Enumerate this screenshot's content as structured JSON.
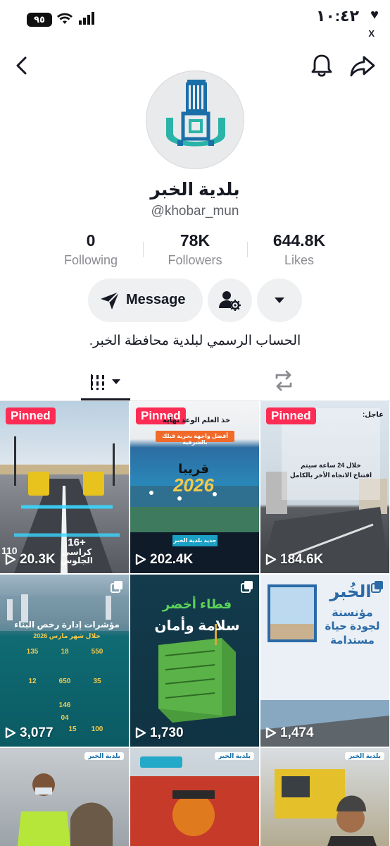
{
  "status_bar": {
    "time": "١٠:٤٢",
    "battery": "٩٥",
    "app_return": "X"
  },
  "profile": {
    "display_name": "بلدية الخبر",
    "handle": "@khobar_mun",
    "bio": "الحساب الرسمي لبلدية محافظة الخبر."
  },
  "stats": {
    "following": {
      "value": "0",
      "label": "Following"
    },
    "followers": {
      "value": "78K",
      "label": "Followers"
    },
    "likes": {
      "value": "644.8K",
      "label": "Likes"
    }
  },
  "actions": {
    "message_label": "Message"
  },
  "videos": [
    {
      "views": "20.3K",
      "pinned_label": "Pinned",
      "overlay_lines": [
        "+16",
        "كراسي",
        "الجلوس",
        "110"
      ]
    },
    {
      "views": "202.4K",
      "pinned_label": "Pinned",
      "overlay_lines": [
        "خذ العلم الوعد نهاية",
        "أفضل واجهة بحرية قبلك بالشرقية",
        "قريبا",
        "2026",
        "جديد بلدية الخبر"
      ]
    },
    {
      "views": "184.6K",
      "pinned_label": "Pinned",
      "overlay_lines": [
        "عاجل:",
        "افتتاح الاتجاه الأخر بالكامل",
        "خلال 24 ساعة سيتم"
      ]
    },
    {
      "views": "3,077",
      "overlay_lines": [
        "مؤشرات إدارة رخص البناء",
        "خلال شهر مارس 2026",
        "550",
        "18",
        "135",
        "35",
        "650",
        "12",
        "146",
        "100",
        "15",
        "04"
      ]
    },
    {
      "views": "1,730",
      "overlay_lines": [
        "فطاء أخضر",
        "سلامة وأمان"
      ]
    },
    {
      "views": "1,474",
      "overlay_lines": [
        "الخُبر",
        "مؤنسنة",
        "لجودة حياة",
        "مستدامة"
      ]
    },
    {
      "overlay_lines": [
        "بلدية الخبر"
      ]
    },
    {
      "overlay_lines": [
        "بلدية الخبر"
      ]
    },
    {
      "overlay_lines": [
        "بلدية الخبر"
      ]
    }
  ],
  "colors": {
    "pinned": "#fe2c55",
    "button_bg": "#eef0f2",
    "text_primary": "#161823",
    "text_secondary": "#8a8b91"
  }
}
